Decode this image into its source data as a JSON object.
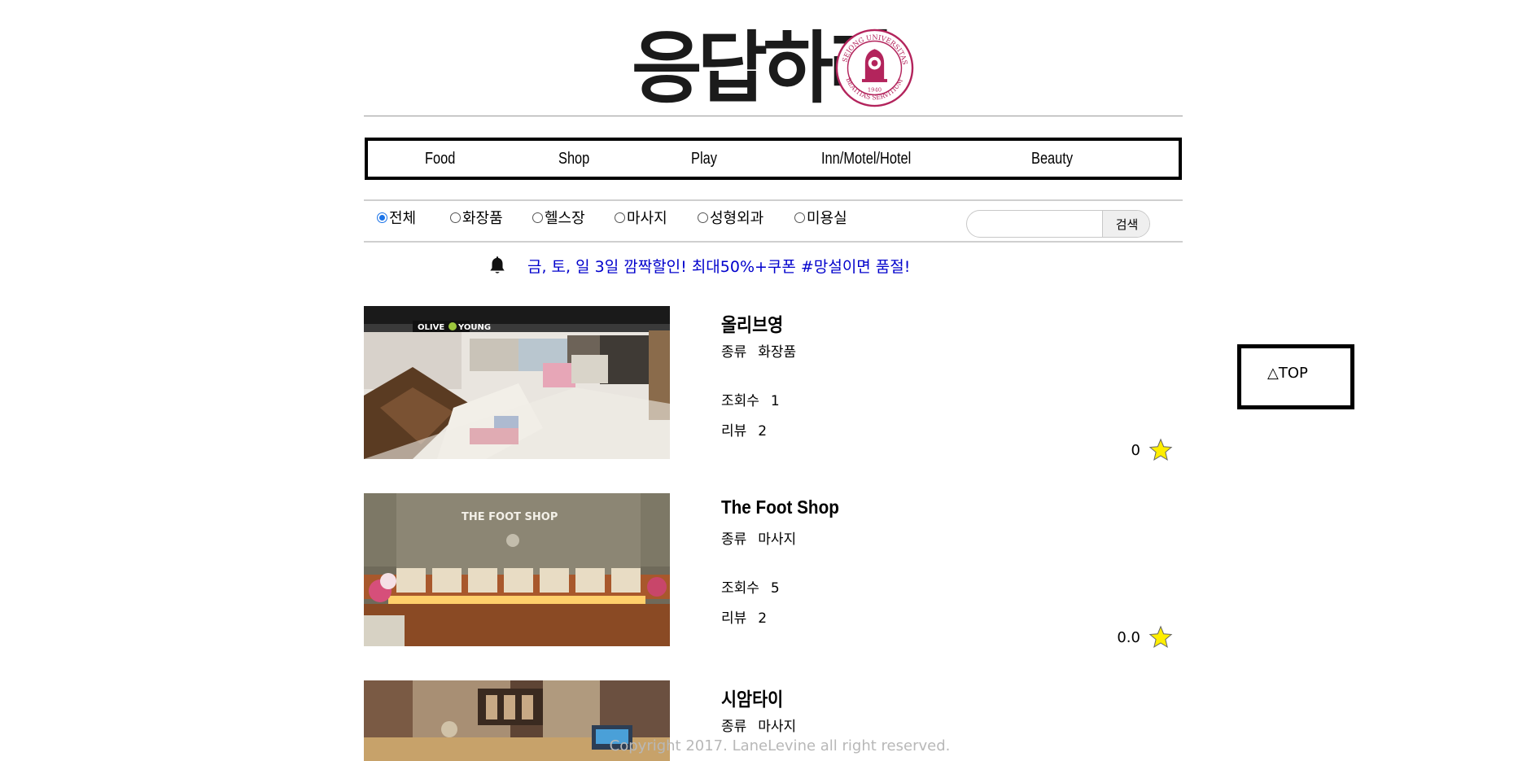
{
  "header": {
    "logo_text": "응답하라",
    "seal_text": "SEJONG UNIVERSITAS · BEATITAS SERVITIUM · 1940"
  },
  "nav": {
    "items": [
      {
        "label": "Food"
      },
      {
        "label": "Shop"
      },
      {
        "label": "Play"
      },
      {
        "label": "Inn/Motel/Hotel"
      },
      {
        "label": "Beauty"
      }
    ]
  },
  "filters": {
    "options": [
      {
        "label": "전체",
        "selected": true
      },
      {
        "label": "화장품",
        "selected": false
      },
      {
        "label": "헬스장",
        "selected": false
      },
      {
        "label": "마사지",
        "selected": false
      },
      {
        "label": "성형외과",
        "selected": false
      },
      {
        "label": "미용실",
        "selected": false
      }
    ],
    "search_value": "",
    "search_button": "검색"
  },
  "notice": {
    "icon": "bell-icon",
    "text": "금, 토, 일 3일 깜짝할인! 최대50%+쿠폰 #망설이면 품절!"
  },
  "listings": [
    {
      "name": "올리브영",
      "type_label": "종류",
      "type": "화장품",
      "views_label": "조회수",
      "views": "1",
      "reviews_label": "리뷰",
      "reviews": "2",
      "rating": "0",
      "image": "olive-young-store-photo"
    },
    {
      "name": "The Foot Shop",
      "type_label": "종류",
      "type": "마사지",
      "views_label": "조회수",
      "views": "5",
      "reviews_label": "리뷰",
      "reviews": "2",
      "rating": "0.0",
      "image": "foot-shop-photo"
    },
    {
      "name": "시암타이",
      "type_label": "종류",
      "type": "마사지",
      "image": "siam-thai-photo"
    }
  ],
  "top_button": "△TOP",
  "footer": "Copyright 2017. LaneLevine all right reserved.",
  "colors": {
    "notice": "#0000cc",
    "star": "#ffee00",
    "radio_selected": "#1a73e8",
    "seal": "#b3245c"
  }
}
